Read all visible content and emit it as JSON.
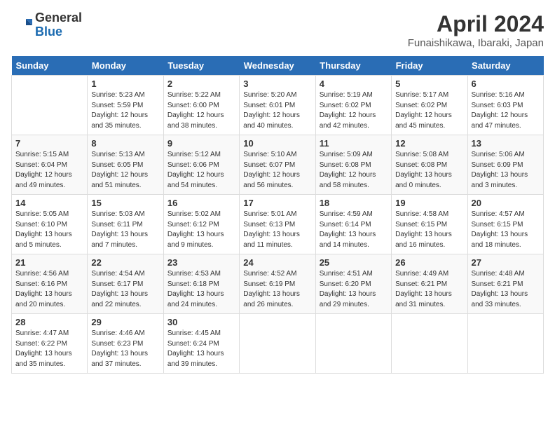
{
  "header": {
    "logo_general": "General",
    "logo_blue": "Blue",
    "title": "April 2024",
    "subtitle": "Funaishikawa, Ibaraki, Japan"
  },
  "calendar": {
    "days_of_week": [
      "Sunday",
      "Monday",
      "Tuesday",
      "Wednesday",
      "Thursday",
      "Friday",
      "Saturday"
    ],
    "weeks": [
      [
        {
          "day": "",
          "info": ""
        },
        {
          "day": "1",
          "info": "Sunrise: 5:23 AM\nSunset: 5:59 PM\nDaylight: 12 hours\nand 35 minutes."
        },
        {
          "day": "2",
          "info": "Sunrise: 5:22 AM\nSunset: 6:00 PM\nDaylight: 12 hours\nand 38 minutes."
        },
        {
          "day": "3",
          "info": "Sunrise: 5:20 AM\nSunset: 6:01 PM\nDaylight: 12 hours\nand 40 minutes."
        },
        {
          "day": "4",
          "info": "Sunrise: 5:19 AM\nSunset: 6:02 PM\nDaylight: 12 hours\nand 42 minutes."
        },
        {
          "day": "5",
          "info": "Sunrise: 5:17 AM\nSunset: 6:02 PM\nDaylight: 12 hours\nand 45 minutes."
        },
        {
          "day": "6",
          "info": "Sunrise: 5:16 AM\nSunset: 6:03 PM\nDaylight: 12 hours\nand 47 minutes."
        }
      ],
      [
        {
          "day": "7",
          "info": "Sunrise: 5:15 AM\nSunset: 6:04 PM\nDaylight: 12 hours\nand 49 minutes."
        },
        {
          "day": "8",
          "info": "Sunrise: 5:13 AM\nSunset: 6:05 PM\nDaylight: 12 hours\nand 51 minutes."
        },
        {
          "day": "9",
          "info": "Sunrise: 5:12 AM\nSunset: 6:06 PM\nDaylight: 12 hours\nand 54 minutes."
        },
        {
          "day": "10",
          "info": "Sunrise: 5:10 AM\nSunset: 6:07 PM\nDaylight: 12 hours\nand 56 minutes."
        },
        {
          "day": "11",
          "info": "Sunrise: 5:09 AM\nSunset: 6:08 PM\nDaylight: 12 hours\nand 58 minutes."
        },
        {
          "day": "12",
          "info": "Sunrise: 5:08 AM\nSunset: 6:08 PM\nDaylight: 13 hours\nand 0 minutes."
        },
        {
          "day": "13",
          "info": "Sunrise: 5:06 AM\nSunset: 6:09 PM\nDaylight: 13 hours\nand 3 minutes."
        }
      ],
      [
        {
          "day": "14",
          "info": "Sunrise: 5:05 AM\nSunset: 6:10 PM\nDaylight: 13 hours\nand 5 minutes."
        },
        {
          "day": "15",
          "info": "Sunrise: 5:03 AM\nSunset: 6:11 PM\nDaylight: 13 hours\nand 7 minutes."
        },
        {
          "day": "16",
          "info": "Sunrise: 5:02 AM\nSunset: 6:12 PM\nDaylight: 13 hours\nand 9 minutes."
        },
        {
          "day": "17",
          "info": "Sunrise: 5:01 AM\nSunset: 6:13 PM\nDaylight: 13 hours\nand 11 minutes."
        },
        {
          "day": "18",
          "info": "Sunrise: 4:59 AM\nSunset: 6:14 PM\nDaylight: 13 hours\nand 14 minutes."
        },
        {
          "day": "19",
          "info": "Sunrise: 4:58 AM\nSunset: 6:15 PM\nDaylight: 13 hours\nand 16 minutes."
        },
        {
          "day": "20",
          "info": "Sunrise: 4:57 AM\nSunset: 6:15 PM\nDaylight: 13 hours\nand 18 minutes."
        }
      ],
      [
        {
          "day": "21",
          "info": "Sunrise: 4:56 AM\nSunset: 6:16 PM\nDaylight: 13 hours\nand 20 minutes."
        },
        {
          "day": "22",
          "info": "Sunrise: 4:54 AM\nSunset: 6:17 PM\nDaylight: 13 hours\nand 22 minutes."
        },
        {
          "day": "23",
          "info": "Sunrise: 4:53 AM\nSunset: 6:18 PM\nDaylight: 13 hours\nand 24 minutes."
        },
        {
          "day": "24",
          "info": "Sunrise: 4:52 AM\nSunset: 6:19 PM\nDaylight: 13 hours\nand 26 minutes."
        },
        {
          "day": "25",
          "info": "Sunrise: 4:51 AM\nSunset: 6:20 PM\nDaylight: 13 hours\nand 29 minutes."
        },
        {
          "day": "26",
          "info": "Sunrise: 4:49 AM\nSunset: 6:21 PM\nDaylight: 13 hours\nand 31 minutes."
        },
        {
          "day": "27",
          "info": "Sunrise: 4:48 AM\nSunset: 6:21 PM\nDaylight: 13 hours\nand 33 minutes."
        }
      ],
      [
        {
          "day": "28",
          "info": "Sunrise: 4:47 AM\nSunset: 6:22 PM\nDaylight: 13 hours\nand 35 minutes."
        },
        {
          "day": "29",
          "info": "Sunrise: 4:46 AM\nSunset: 6:23 PM\nDaylight: 13 hours\nand 37 minutes."
        },
        {
          "day": "30",
          "info": "Sunrise: 4:45 AM\nSunset: 6:24 PM\nDaylight: 13 hours\nand 39 minutes."
        },
        {
          "day": "",
          "info": ""
        },
        {
          "day": "",
          "info": ""
        },
        {
          "day": "",
          "info": ""
        },
        {
          "day": "",
          "info": ""
        }
      ]
    ]
  }
}
